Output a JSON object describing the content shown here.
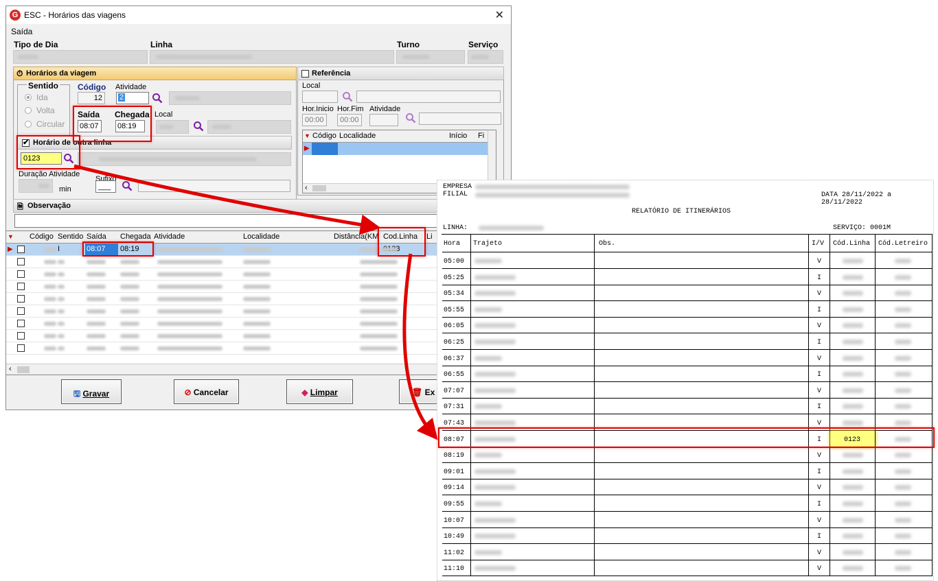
{
  "window": {
    "title": "ESC - Horários das viagens",
    "close": "✕",
    "menu": "Saída"
  },
  "header": {
    "tipo_dia_label": "Tipo de Dia",
    "linha_label": "Linha",
    "turno_label": "Turno",
    "servico_label": "Serviço"
  },
  "horarios": {
    "group_title": "Horários da viagem",
    "sentido_label": "Sentido",
    "ida": "Ida",
    "volta": "Volta",
    "circular": "Circular",
    "codigo_label": "Código",
    "codigo_value": "12",
    "atividade_label": "Atividade",
    "atividade_value": "2",
    "saida_label": "Saída",
    "saida_value": "08:07",
    "chegada_label": "Chegada",
    "chegada_value": "08:19",
    "local_label": "Local",
    "outra_linha_label": "Horário de outra linha",
    "outra_linha_value": "0123",
    "duracao_label": "Duração Atividade",
    "min_label": "min",
    "sufixo_label": "Sufixo",
    "sufixo_value": "___"
  },
  "referencia": {
    "title": "Referência",
    "local_label": "Local",
    "hor_inicio_label": "Hor.Inicio",
    "hor_inicio_value": "00:00",
    "hor_fim_label": "Hor.Fim",
    "hor_fim_value": "00:00",
    "atividade_label": "Atividade",
    "grid_cols": [
      "Código",
      "Localidade",
      "Início",
      "Fi"
    ]
  },
  "observacao": {
    "title": "Observação"
  },
  "grid": {
    "columns": [
      "Código",
      "Sentido",
      "Saída",
      "Chegada",
      "Atividade",
      "Localidade",
      "Distância(KM",
      "Cod.Linha",
      "Li"
    ],
    "first_row": {
      "sentido": "I",
      "saida": "08:07",
      "chegada": "08:19",
      "cod_linha": "0123"
    }
  },
  "buttons": {
    "gravar": "Gravar",
    "cancelar": "Cancelar",
    "limpar": "Limpar",
    "excluir": "Ex"
  },
  "report": {
    "empresa": "EMPRESA",
    "filial": "FILIAL",
    "data": "DATA 28/11/2022 a 28/11/2022",
    "title": "RELATÓRIO DE ITINERÁRIOS",
    "linha_label": "LINHA:",
    "servico": "SERVIÇO: 0001M",
    "cols": [
      "Hora",
      "Trajeto",
      "Obs.",
      "I/V",
      "Cód.Linha",
      "Cód.Letreiro"
    ],
    "rows": [
      {
        "hora": "05:00",
        "iv": "V"
      },
      {
        "hora": "05:25",
        "iv": "I"
      },
      {
        "hora": "05:34",
        "iv": "V"
      },
      {
        "hora": "05:55",
        "iv": "I"
      },
      {
        "hora": "06:05",
        "iv": "V"
      },
      {
        "hora": "06:25",
        "iv": "I"
      },
      {
        "hora": "06:37",
        "iv": "V"
      },
      {
        "hora": "06:55",
        "iv": "I"
      },
      {
        "hora": "07:07",
        "iv": "V"
      },
      {
        "hora": "07:31",
        "iv": "I"
      },
      {
        "hora": "07:43",
        "iv": "V"
      },
      {
        "hora": "08:07",
        "iv": "I",
        "cod_linha": "0123"
      },
      {
        "hora": "08:19",
        "iv": "V"
      },
      {
        "hora": "09:01",
        "iv": "I"
      },
      {
        "hora": "09:14",
        "iv": "V"
      },
      {
        "hora": "09:55",
        "iv": "I"
      },
      {
        "hora": "10:07",
        "iv": "V"
      },
      {
        "hora": "10:49",
        "iv": "I"
      },
      {
        "hora": "11:02",
        "iv": "V"
      },
      {
        "hora": "11:10",
        "iv": "V"
      }
    ]
  },
  "colors": {
    "highlight": "#e00000",
    "selection": "#3a8ee6",
    "yellow": "#ffff80"
  }
}
